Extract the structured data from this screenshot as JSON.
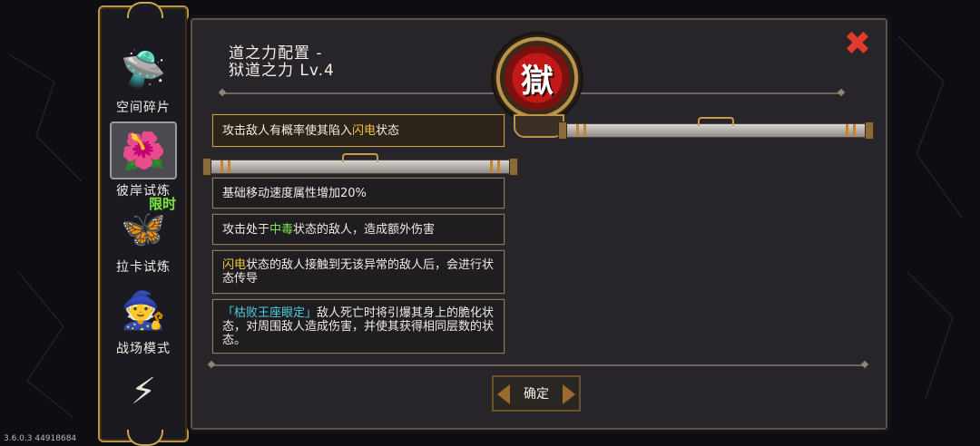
{
  "side_nav": {
    "items": [
      {
        "label": "空间碎片",
        "icon": "machine-icon",
        "glyph": "🛸"
      },
      {
        "label": "彼岸试炼",
        "icon": "red-flower-icon",
        "glyph": "🌺"
      },
      {
        "label": "拉卡试炼",
        "icon": "winged-emblem-icon",
        "glyph": "🦋",
        "badge": "限时"
      },
      {
        "label": "战场模式",
        "icon": "wizard-icon",
        "glyph": "🧙"
      },
      {
        "label": "",
        "icon": "lightning-icon",
        "glyph": "⚡"
      }
    ]
  },
  "panel": {
    "title": "道之力配置 -\n狱道之力 Lv.4",
    "emblem_glyph": "獄",
    "close_glyph": "✖",
    "effects": [
      {
        "segments": [
          {
            "text": "攻击敌人有概率使其陷入",
            "hl": ""
          },
          {
            "text": "闪电",
            "hl": "yellow"
          },
          {
            "text": "状态",
            "hl": ""
          }
        ],
        "selected": true
      },
      {
        "segments": [
          {
            "text": "基础移动速度属性增加20%",
            "hl": ""
          }
        ],
        "selected": false
      },
      {
        "segments": [
          {
            "text": "攻击处于",
            "hl": ""
          },
          {
            "text": "中毒",
            "hl": "green"
          },
          {
            "text": "状态的敌人，造成额外伤害",
            "hl": ""
          }
        ],
        "selected": false
      },
      {
        "segments": [
          {
            "text": "闪电",
            "hl": "yellow"
          },
          {
            "text": "状态的敌人接触到无该异常的敌人后，会进行状态传导",
            "hl": ""
          }
        ],
        "selected": false
      },
      {
        "segments": [
          {
            "text": "「枯败王座眼定」",
            "hl": "cyan"
          },
          {
            "text": "敌人死亡时将引爆其身上的脆化状态，对周围敌人造成伤害，并使其获得相同层数的状态。",
            "hl": ""
          }
        ],
        "selected": false
      }
    ],
    "confirm_label": "确定"
  },
  "version": "3.6.0.3 44918684",
  "colors": {
    "accent_gold": "#b8954a",
    "close_red": "#e23b2e",
    "highlight_yellow": "#f0c240",
    "highlight_green": "#7be04a",
    "highlight_cyan": "#4ad0e0"
  }
}
